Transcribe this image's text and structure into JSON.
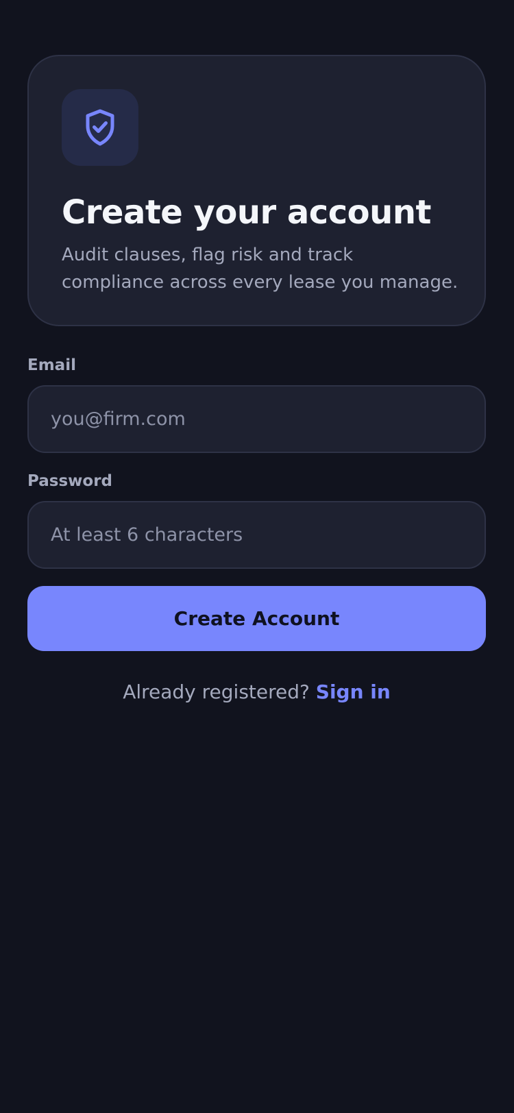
{
  "hero": {
    "icon": "shield-check-icon",
    "title": "Create your account",
    "subtitle": "Audit clauses, flag risk and track compliance across every lease you manage."
  },
  "form": {
    "email": {
      "label": "Email",
      "value": "",
      "placeholder": "you@firm.com"
    },
    "password": {
      "label": "Password",
      "value": "",
      "placeholder": "At least 6 characters"
    },
    "submit_label": "Create Account"
  },
  "footer": {
    "prompt": "Already registered?",
    "link_label": "Sign in"
  },
  "colors": {
    "background": "#11131e",
    "card": "#1e2130",
    "accent": "#7886fd",
    "muted_text": "#a4a9bd"
  }
}
